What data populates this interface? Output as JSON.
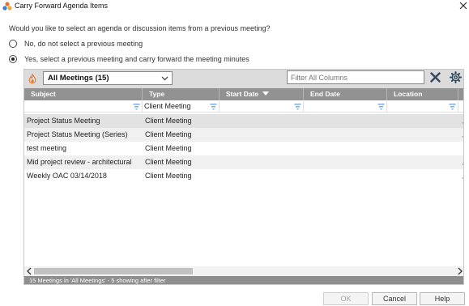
{
  "window": {
    "title": "Carry Forward Agenda Items"
  },
  "question": "Would you like to select an agenda or discussion items from a previous meeting?",
  "options": [
    {
      "label": "No, do not select a previous meeting",
      "selected": false
    },
    {
      "label": "Yes, select a previous meeting and carry forward the meeting minutes",
      "selected": true
    }
  ],
  "toolbar": {
    "view_select": "All Meetings (15)",
    "filter_placeholder": "Filter All Columns"
  },
  "columns": [
    "Subject",
    "Type",
    "Start Date",
    "End Date",
    "Location"
  ],
  "sorted_column": "Start Date",
  "filters": {
    "type": "Client Meeting"
  },
  "rows": [
    {
      "subject": "Project Status Meeting",
      "type": "Client Meeting"
    },
    {
      "subject": "Project Status Meeting (Series)",
      "type": "Client Meeting"
    },
    {
      "subject": "test meeting",
      "type": "Client Meeting"
    },
    {
      "subject": "Mid project review - architectural",
      "type": "Client Meeting"
    },
    {
      "subject": "Weekly OAC 03/14/2018",
      "type": "Client Meeting"
    }
  ],
  "status": "15 Meetings in 'All Meetings' - 5 showing after filter",
  "buttons": {
    "ok": "OK",
    "cancel": "Cancel",
    "help": "Help"
  },
  "colors": {
    "header": "#929292",
    "toolbar": "#dcdcdc",
    "status_bar": "#8e8e8e",
    "clear_icon": "#2f4a60",
    "settings_icon": "#2f4a60",
    "app_icon_orange": "#e8742c",
    "app_icon_blue": "#3b7dd8"
  }
}
